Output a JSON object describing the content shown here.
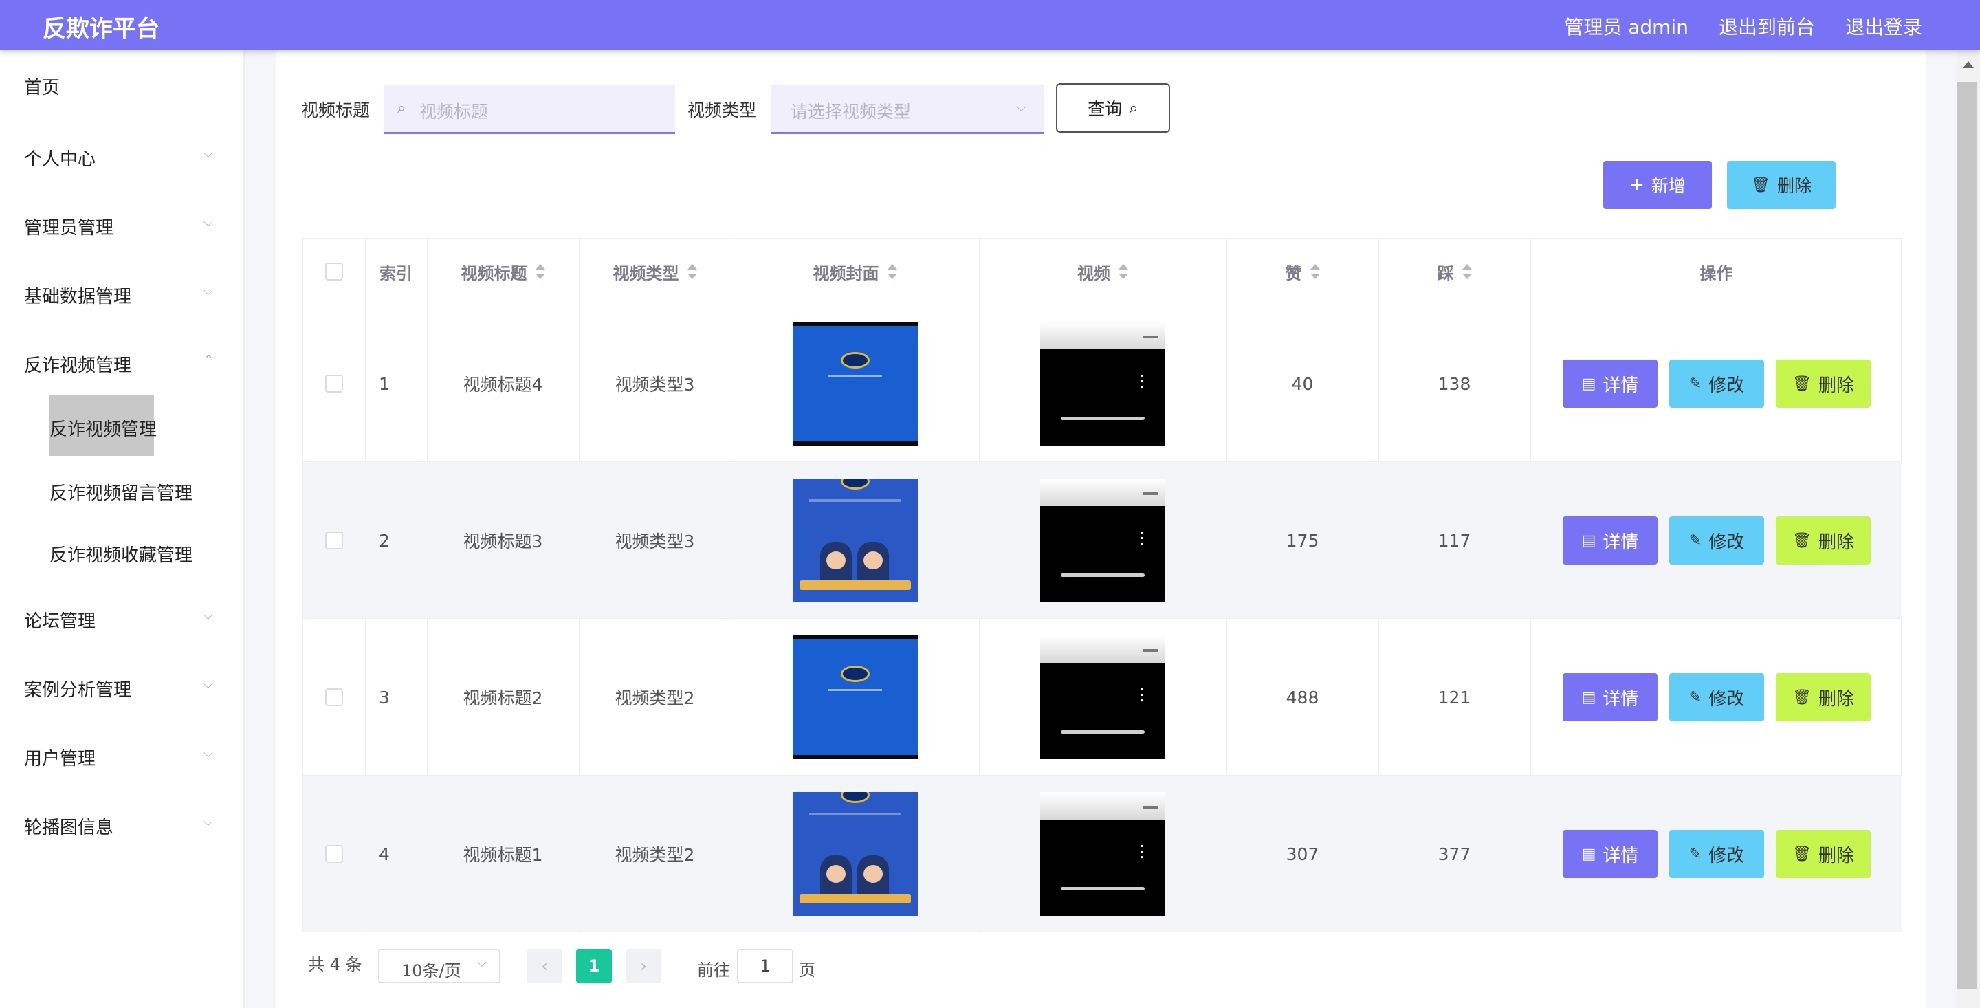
{
  "header": {
    "brand": "反欺诈平台",
    "admin_label": "管理员 admin",
    "to_front": "退出到前台",
    "logout": "退出登录"
  },
  "sidebar": {
    "items": [
      {
        "label": "首页",
        "has_chevron": false
      },
      {
        "label": "个人中心",
        "has_chevron": true
      },
      {
        "label": "管理员管理",
        "has_chevron": true
      },
      {
        "label": "基础数据管理",
        "has_chevron": true
      },
      {
        "label": "反诈视频管理",
        "has_chevron": true,
        "expanded": true
      },
      {
        "label": "论坛管理",
        "has_chevron": true
      },
      {
        "label": "案例分析管理",
        "has_chevron": true
      },
      {
        "label": "用户管理",
        "has_chevron": true
      },
      {
        "label": "轮播图信息",
        "has_chevron": true
      }
    ],
    "submenu": [
      {
        "label": "反诈视频管理",
        "active": true
      },
      {
        "label": "反诈视频留言管理",
        "active": false
      },
      {
        "label": "反诈视频收藏管理",
        "active": false
      }
    ]
  },
  "search": {
    "title_label": "视频标题",
    "title_placeholder": "视频标题",
    "type_label": "视频类型",
    "type_placeholder": "请选择视频类型",
    "query_button": "查询"
  },
  "toolbar": {
    "add_label": "新增",
    "delete_label": "删除"
  },
  "table": {
    "columns": [
      "索引",
      "视频标题",
      "视频类型",
      "视频封面",
      "视频",
      "赞",
      "踩",
      "操作"
    ],
    "rows": [
      {
        "index": "1",
        "title": "视频标题4",
        "type": "视频类型3",
        "likes": "40",
        "dislikes": "138",
        "cover_style": "blue-screen"
      },
      {
        "index": "2",
        "title": "视频标题3",
        "type": "视频类型3",
        "likes": "175",
        "dislikes": "117",
        "cover_style": "cartoon-police"
      },
      {
        "index": "3",
        "title": "视频标题2",
        "type": "视频类型2",
        "likes": "488",
        "dislikes": "121",
        "cover_style": "blue-screen"
      },
      {
        "index": "4",
        "title": "视频标题1",
        "type": "视频类型2",
        "likes": "307",
        "dislikes": "377",
        "cover_style": "cartoon-police"
      }
    ],
    "actions": {
      "detail": "详情",
      "edit": "修改",
      "delete": "删除"
    }
  },
  "pagination": {
    "total": "共 4 条",
    "page_size": "10条/页",
    "current_page": "1",
    "goto_label": "前往",
    "goto_value": "1",
    "page_unit": "页"
  },
  "colors": {
    "header": "#7873f5",
    "primary": "#7873f5",
    "info": "#62cdf7",
    "delete_row": "#c6f54d",
    "pager_active": "#19c79b"
  }
}
